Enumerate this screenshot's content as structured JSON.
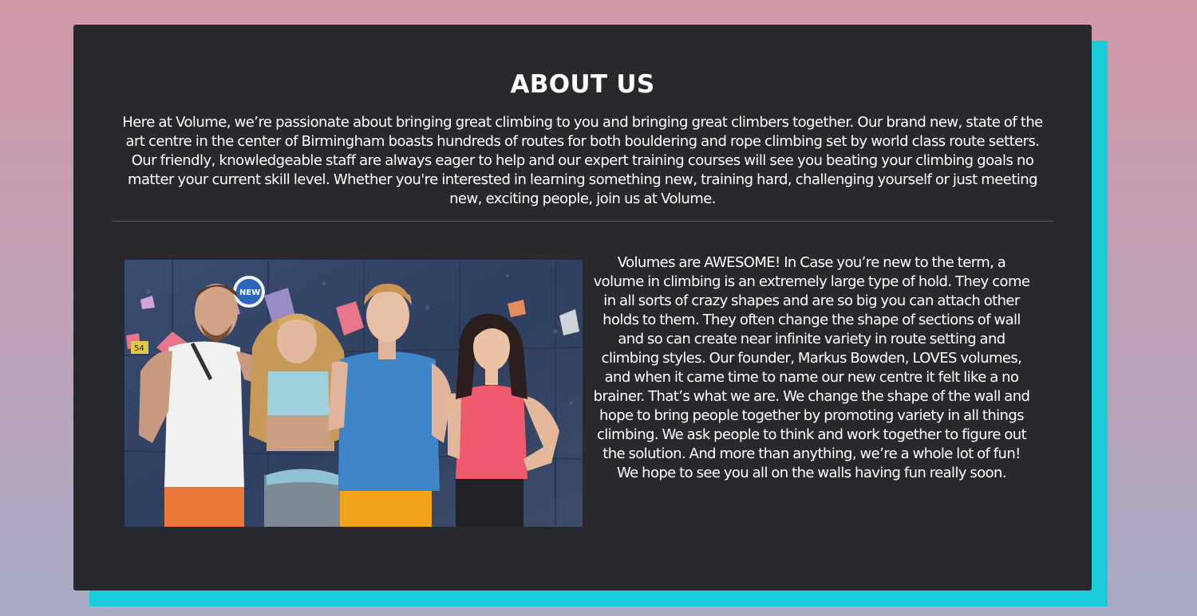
{
  "about": {
    "title": "ABOUT US",
    "intro": "Here at Volume, we’re passionate about bringing great climbing to you and bringing great climbers together. Our brand new, state of the art centre in the center of Birmingham boasts hundreds of routes for both bouldering and rope climbing set by world class route setters. Our friendly, knowledgeable staff are always eager to help and our expert training courses will see you beating your climbing goals no matter your current skill level. Whether you're interested in learning something new, training hard, challenging yourself or just meeting new, exciting people, join us at Volume.",
    "volumes_text": "Volumes are AWESOME! In Case you’re new to the term, a volume in climbing is an extremely large type of hold. They come in all sorts of crazy shapes and are so big you can attach other holds to them. They often change the shape of sections of wall and so can create near infinite variety in route setting and climbing styles. Our founder, Markus Bowden, LOVES volumes, and when it came time to name our new centre it felt like a no brainer. That’s what we are. We change the shape of the wall and hope to bring people together by promoting variety in all things climbing. We ask people to think and work together to figure out the solution. And more than anything, we’re a whole lot of fun! We hope to see you all on the walls having fun really soon."
  },
  "photo": {
    "wall_sign": "NEW",
    "hold_tag": "54"
  },
  "colors": {
    "accent": "#1ccbd8",
    "card": "#28292f",
    "text": "#ffffff"
  }
}
